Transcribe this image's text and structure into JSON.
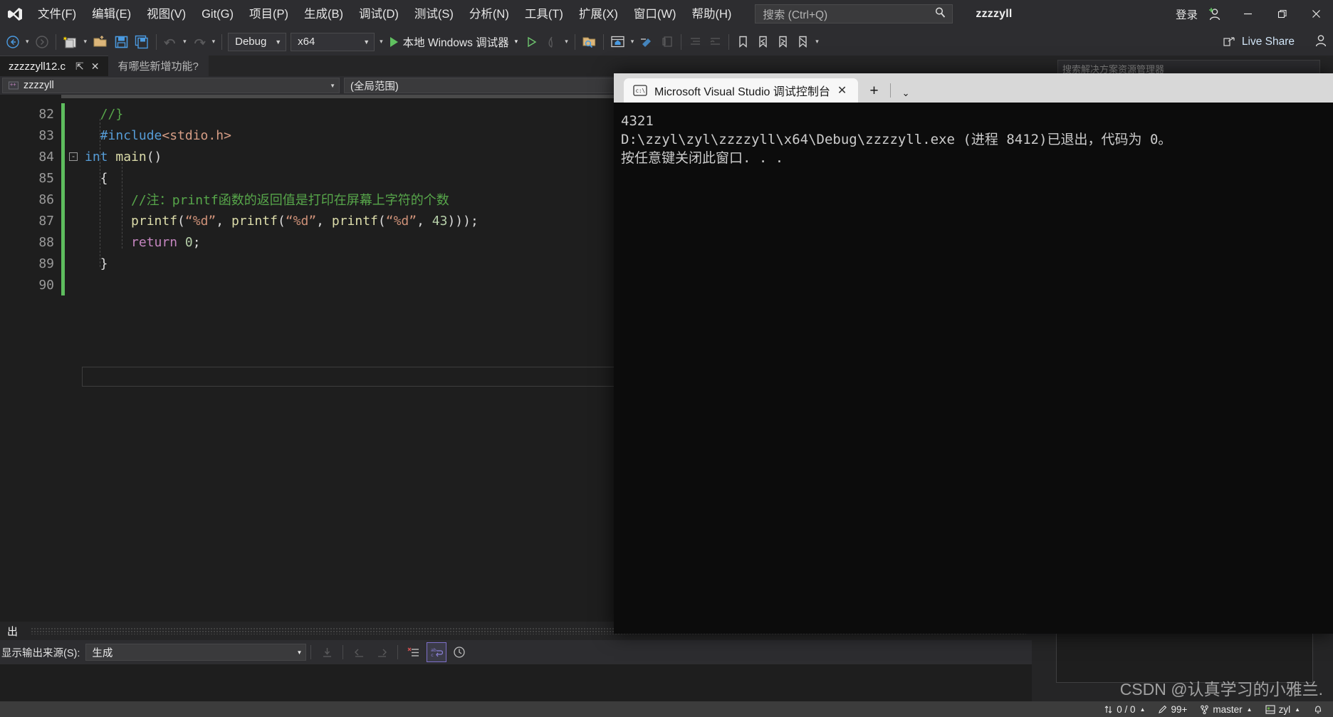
{
  "window": {
    "project_title": "zzzzyll",
    "signin_label": "登录",
    "minimize_label": "—",
    "maximize_label": "❐",
    "close_label": "✕"
  },
  "menu": {
    "items": [
      {
        "label": "文件(F)"
      },
      {
        "label": "编辑(E)"
      },
      {
        "label": "视图(V)"
      },
      {
        "label": "Git(G)"
      },
      {
        "label": "项目(P)"
      },
      {
        "label": "生成(B)"
      },
      {
        "label": "调试(D)"
      },
      {
        "label": "测试(S)"
      },
      {
        "label": "分析(N)"
      },
      {
        "label": "工具(T)"
      },
      {
        "label": "扩展(X)"
      },
      {
        "label": "窗口(W)"
      },
      {
        "label": "帮助(H)"
      }
    ]
  },
  "search": {
    "placeholder": "搜索 (Ctrl+Q)",
    "icon": "search-icon"
  },
  "toolbar": {
    "configuration": "Debug",
    "platform": "x64",
    "run_label": "本地 Windows 调试器",
    "live_share_label": "Live Share"
  },
  "tabs": {
    "active": "zzzzzyll12.c",
    "inactive": "有哪些新增功能?",
    "pin_glyph": "⇱",
    "close_glyph": "✕"
  },
  "navbar": {
    "project": "zzzzyll",
    "scope": "(全局范围)"
  },
  "editor": {
    "lines": [
      {
        "number": "82",
        "fold": "",
        "tokens": [
          {
            "text": "  //}",
            "cls": "k-green"
          }
        ]
      },
      {
        "number": "83",
        "fold": "",
        "tokens": [
          {
            "text": "  #include",
            "cls": "k-blue"
          },
          {
            "text": "<stdio.h>",
            "cls": "k-pink"
          }
        ]
      },
      {
        "number": "84",
        "fold": "-",
        "tokens": [
          {
            "text": "int",
            "cls": "k-blue"
          },
          {
            "text": " ",
            "cls": "k-white"
          },
          {
            "text": "main",
            "cls": "k-yellow"
          },
          {
            "text": "()",
            "cls": "k-white"
          }
        ]
      },
      {
        "number": "85",
        "fold": "",
        "tokens": [
          {
            "text": "  {",
            "cls": "k-white"
          }
        ]
      },
      {
        "number": "86",
        "fold": "",
        "tokens": [
          {
            "text": "      //注：printf函数的返回值是打印在屏幕上字符的个数",
            "cls": "k-green"
          }
        ]
      },
      {
        "number": "87",
        "fold": "",
        "tokens": [
          {
            "text": "      printf",
            "cls": "k-yellow"
          },
          {
            "text": "(",
            "cls": "k-white"
          },
          {
            "text": "“%d”",
            "cls": "k-orange"
          },
          {
            "text": ", ",
            "cls": "k-white"
          },
          {
            "text": "printf",
            "cls": "k-yellow"
          },
          {
            "text": "(",
            "cls": "k-white"
          },
          {
            "text": "“%d”",
            "cls": "k-orange"
          },
          {
            "text": ", ",
            "cls": "k-white"
          },
          {
            "text": "printf",
            "cls": "k-yellow"
          },
          {
            "text": "(",
            "cls": "k-white"
          },
          {
            "text": "“%d”",
            "cls": "k-orange"
          },
          {
            "text": ", ",
            "cls": "k-white"
          },
          {
            "text": "43",
            "cls": "k-num"
          },
          {
            "text": ")));",
            "cls": "k-white"
          }
        ]
      },
      {
        "number": "88",
        "fold": "",
        "tokens": [
          {
            "text": "      return",
            "cls": "k-mag"
          },
          {
            "text": " ",
            "cls": "k-white"
          },
          {
            "text": "0",
            "cls": "k-num"
          },
          {
            "text": ";",
            "cls": "k-white"
          }
        ]
      },
      {
        "number": "89",
        "fold": "",
        "tokens": [
          {
            "text": "  }",
            "cls": "k-white"
          }
        ]
      },
      {
        "number": "90",
        "fold": "",
        "tokens": [
          {
            "text": "",
            "cls": "k-white"
          }
        ]
      }
    ]
  },
  "output_panel": {
    "tab_label": "出",
    "source_label": "显示输出来源(S):",
    "source_value": "生成",
    "buttons": [
      {
        "name": "jump-to-source-button",
        "glyph": "⤓"
      },
      {
        "name": "previous-message-button",
        "glyph": "⇐"
      },
      {
        "name": "next-message-button",
        "glyph": "⇒"
      },
      {
        "name": "clear-all-button",
        "glyph": "✕☰"
      },
      {
        "name": "toggle-word-wrap-button",
        "glyph": "⏎"
      },
      {
        "name": "show-timestamps-button",
        "glyph": "🕘"
      }
    ]
  },
  "right_dock": {
    "search_placeholder": "搜索解决方案资源管理器"
  },
  "console": {
    "tab_title": "Microsoft Visual Studio 调试控制台",
    "tab_icon": "terminal-icon",
    "close_glyph": "✕",
    "new_tab_glyph": "+",
    "chevron_glyph": "⌄",
    "output_lines": [
      "4321",
      "D:\\zzyl\\zyl\\zzzzyll\\x64\\Debug\\zzzzyll.exe (进程 8412)已退出，代码为 0。",
      "按任意键关闭此窗口. . ."
    ]
  },
  "statusbar": {
    "items": [
      {
        "name": "source-control-changes",
        "icon": "updown-arrow-icon",
        "label": "0 / 0",
        "caret": "▲"
      },
      {
        "name": "pending-edits",
        "icon": "pencil-icon",
        "label": "99+",
        "caret": ""
      },
      {
        "name": "git-branch",
        "icon": "branch-icon",
        "label": "master",
        "caret": "▲"
      },
      {
        "name": "git-repository",
        "icon": "repo-icon",
        "label": "zyl",
        "caret": "▲"
      },
      {
        "name": "notifications",
        "icon": "bell-icon",
        "label": "",
        "caret": ""
      }
    ]
  },
  "watermark": {
    "text": "CSDN @认真学习的小雅兰."
  }
}
